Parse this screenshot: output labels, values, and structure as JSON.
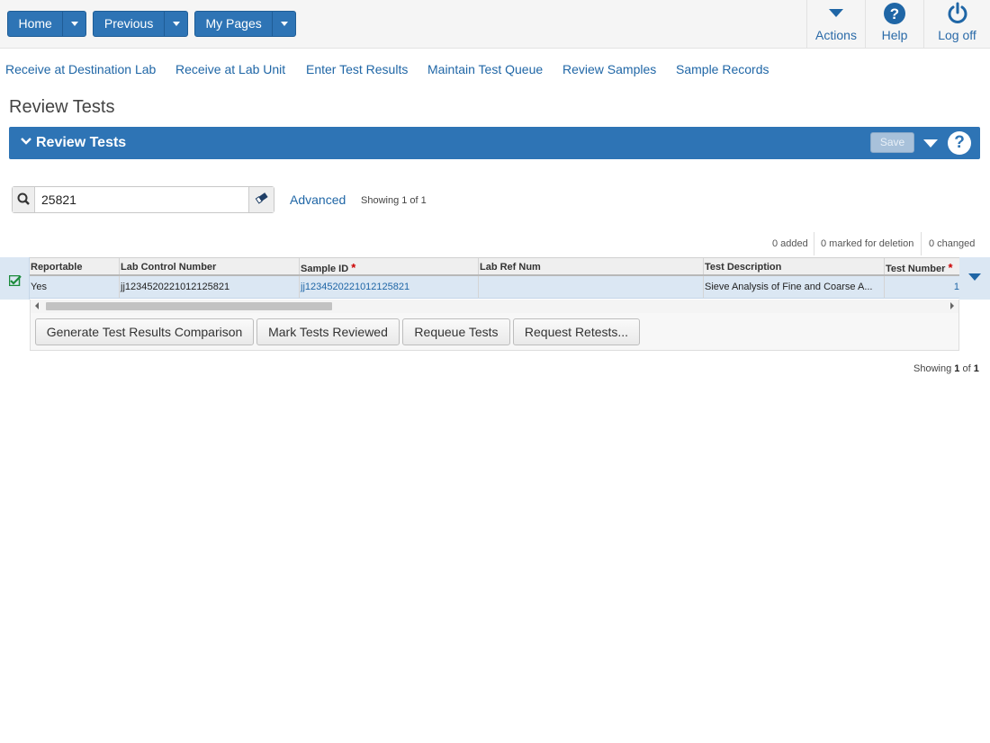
{
  "topbar": {
    "home_label": "Home",
    "previous_label": "Previous",
    "mypages_label": "My Pages",
    "actions_label": "Actions",
    "help_label": "Help",
    "logoff_label": "Log off"
  },
  "nav_links": [
    "Receive at Destination Lab",
    "Receive at Lab Unit",
    "Enter Test Results",
    "Maintain Test Queue",
    "Review Samples",
    "Sample Records"
  ],
  "page": {
    "title": "Review Tests",
    "panel_title": "Review Tests",
    "save_label": "Save",
    "help_glyph": "?"
  },
  "search": {
    "value": "25821",
    "advanced_label": "Advanced",
    "showing_text": "Showing 1 of 1"
  },
  "counts": {
    "added": "0 added",
    "marked": "0 marked for deletion",
    "changed": "0 changed"
  },
  "grid": {
    "columns": [
      "Reportable",
      "Lab Control Number",
      "Sample ID",
      "Lab Ref Num",
      "Test Description",
      "Test Number"
    ],
    "required_marker": "*",
    "rows": [
      {
        "reportable": "Yes",
        "lab_control_number": "jj1234520221012125821",
        "sample_id": "jj1234520221012125821",
        "lab_ref_num": "",
        "test_description": "Sieve Analysis of Fine and Coarse A...",
        "test_number": "1"
      }
    ],
    "selected": true
  },
  "actions": {
    "generate_label": "Generate Test Results Comparison",
    "mark_label": "Mark Tests Reviewed",
    "requeue_label": "Requeue Tests",
    "retest_label": "Request Retests..."
  },
  "footer": {
    "showing_prefix": "Showing",
    "current": "1",
    "of_text": "of",
    "total": "1"
  },
  "colors": {
    "brand_blue": "#2e74b5",
    "link_blue": "#1f66a6",
    "selected_row": "#dbe7f3",
    "required_red": "#cc0000"
  }
}
